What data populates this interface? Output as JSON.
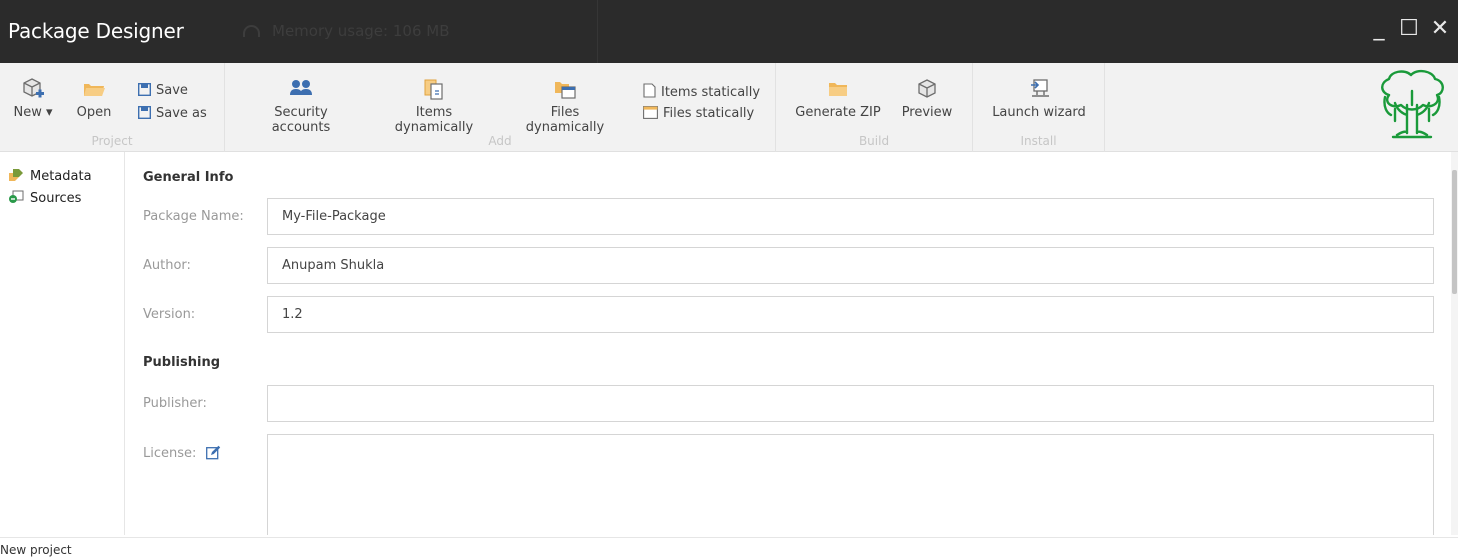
{
  "app": {
    "title": "Package Designer",
    "memory_label": "Memory usage: 106 MB"
  },
  "window_controls": {
    "minimize": "_",
    "maximize": "☐",
    "close": "✕"
  },
  "ribbon": {
    "project": {
      "caption": "Project",
      "new_label": "New ▾",
      "open_label": "Open",
      "save_label": "Save",
      "save_as_label": "Save as"
    },
    "add": {
      "caption": "Add",
      "security_accounts_label": "Security accounts",
      "items_dynamically_label": "Items dynamically",
      "files_dynamically_label": "Files dynamically",
      "items_statically_label": "Items statically",
      "files_statically_label": "Files statically"
    },
    "build": {
      "caption": "Build",
      "generate_zip_label": "Generate ZIP",
      "preview_label": "Preview"
    },
    "install": {
      "caption": "Install",
      "launch_wizard_label": "Launch wizard"
    }
  },
  "icons": {
    "new": "package-new-icon",
    "open": "folder-open-icon",
    "save": "floppy-disk-icon",
    "save_as": "floppy-disk-icon",
    "security": "users-icon",
    "items_dynamic": "documents-icon",
    "files_dynamic": "folder-window-icon",
    "items_static": "document-icon",
    "files_static": "window-icon",
    "generate_zip": "folder-icon",
    "preview": "package-icon",
    "launch_wizard": "install-icon",
    "logo": "tree-logo",
    "metadata": "tags-icon",
    "sources": "sources-icon",
    "license_edit": "edit-icon"
  },
  "nav": {
    "metadata_label": "Metadata",
    "sources_label": "Sources"
  },
  "form": {
    "general_info_title": "General Info",
    "package_name_label": "Package Name:",
    "package_name_value": "My-File-Package",
    "author_label": "Author:",
    "author_value": "Anupam Shukla",
    "version_label": "Version:",
    "version_value": "1.2",
    "publishing_title": "Publishing",
    "publisher_label": "Publisher:",
    "publisher_value": "",
    "license_label": "License:"
  },
  "status": {
    "text": "New project"
  },
  "colors": {
    "titlebar": "#2b2b2b",
    "ribbon": "#f2f2f2",
    "accent_blue": "#3d6fb0",
    "folder_orange": "#f0b75a",
    "logo_green": "#1a9a3a"
  }
}
